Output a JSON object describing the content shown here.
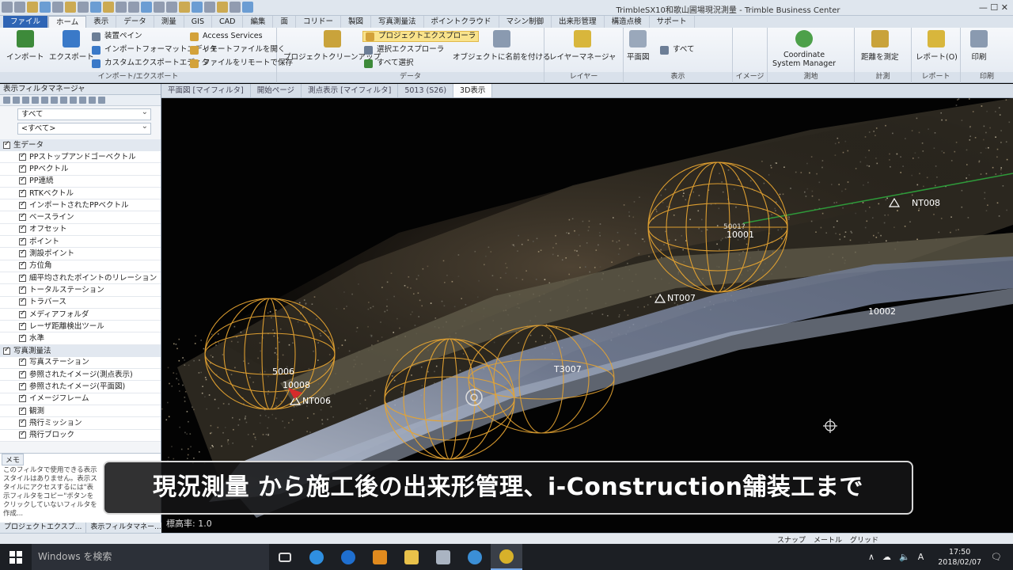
{
  "app": {
    "title": "TrimbleSX10和歌山圃場現況測量 - Trimble Business Center",
    "window_controls": "— ☐ ✕"
  },
  "ribbon_tabs": [
    "ファイル",
    "ホーム",
    "表示",
    "データ",
    "測量",
    "GIS",
    "CAD",
    "編集",
    "面",
    "コリドー",
    "製図",
    "写真測量法",
    "ポイントクラウド",
    "マシン制御",
    "出来形管理",
    "構造点検",
    "サポート"
  ],
  "ribbon": {
    "import_group": {
      "label": "インポート/エクスポート",
      "import": "インポート",
      "export": "エクスポート",
      "device_pane": "装置ペイン",
      "import_format_editor": "インポートフォーマットエディタ",
      "custom_export_editor": "カスタムエクスポートエディタ",
      "access_services": "Access Services",
      "open_remote_file": "リモートファイルを開く",
      "save_remote_file": "ファイルをリモートで保存"
    },
    "data_group": {
      "label": "データ",
      "project_cleanup": "プロジェクトクリーンアップ",
      "project_explorer": "プロジェクトエクスプローラ",
      "selection_explorer": "選択エクスプローラ",
      "select_all": "すべて選択",
      "name_objects": "オブジェクトに名前を付ける"
    },
    "layer_group": {
      "label": "レイヤー",
      "layer_manager": "レイヤーマネージャ"
    },
    "view_group": {
      "label": "表示",
      "plan_view": "平面図",
      "filter_all": "すべて"
    },
    "image_group": {
      "label": "イメージ"
    },
    "survey_group": {
      "label": "測地",
      "coord_system": "Coordinate\nSystem Manager"
    },
    "measure_group": {
      "label": "計測",
      "measure_distance": "距離を測定"
    },
    "report_group": {
      "label": "レポート",
      "report": "レポート(O)"
    },
    "print_group": {
      "label": "印刷",
      "print": "印刷"
    }
  },
  "left_panel": {
    "title": "表示フィルタマネージャ",
    "filter_combo": "すべて",
    "filter_combo2": "<すべて>",
    "groups": [
      {
        "name": "生データ",
        "items": [
          "PPストップアンドゴーベクトル",
          "PPベクトル",
          "PP連続",
          "RTKベクトル",
          "インポートされたPPベクトル",
          "ベースライン",
          "オフセット",
          "ポイント",
          "測設ポイント",
          "方位角",
          "細平均されたポイントのリレーション",
          "トータルステーション",
          "トラバース",
          "メディアフォルダ",
          "レーザ距離検出ツール",
          "水準"
        ]
      },
      {
        "name": "写真測量法",
        "items": [
          "写真ステーション",
          "参照されたイメージ(測点表示)",
          "参照されたイメージ(平面図)",
          "イメージフレーム",
          "観測",
          "飛行ミッション",
          "飛行ブロック"
        ]
      }
    ],
    "memo_tab": "メモ",
    "memo_text": "このフィルタで使用できる表示スタイルはありません。表示スタイルにアクセスするには\"表示フィルタをコピー\"ボタンをクリックしていないフィルタを作成...",
    "bottom_tabs": [
      "プロジェクトエクスプ...",
      "表示フィルタマネー..."
    ]
  },
  "doc_tabs": [
    "平面図 [マイフィルタ]",
    "開始ページ",
    "測点表示 [マイフィルタ]",
    "5013 (S26)",
    "3D表示"
  ],
  "viewport": {
    "labels": [
      "NT008",
      "10001",
      "5001?",
      "NT007",
      "10002",
      "5006",
      "10008",
      "NT006",
      "T3007"
    ],
    "elevation": "標高率: 1.0"
  },
  "caption": "現況測量 から施工後の出来形管理、i-Construction舗装工まで",
  "statusbar": [
    "スナップ",
    "メートル",
    "グリッド"
  ],
  "taskbar": {
    "search": "Windows を検索",
    "time": "17:50",
    "date": "2018/02/07"
  },
  "colors": {
    "sphere": "#e6a431",
    "accent": "#2f65b5",
    "caption_bg": "#141416"
  }
}
